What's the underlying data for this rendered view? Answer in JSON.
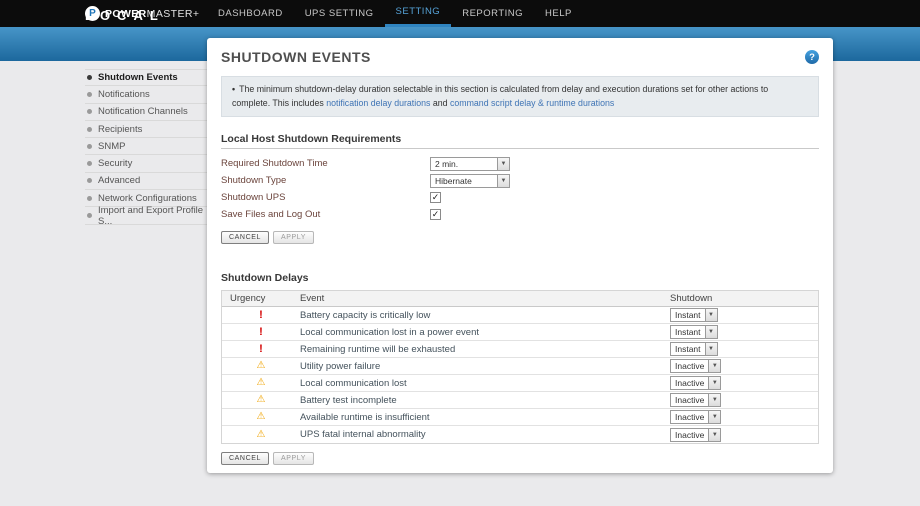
{
  "topbar": {
    "logo_letter": "P",
    "brand_bold": "POWER",
    "brand_light": "MASTER+",
    "nav": [
      {
        "label": "DASHBOARD"
      },
      {
        "label": "UPS SETTING"
      },
      {
        "label": "SETTING"
      },
      {
        "label": "REPORTING"
      },
      {
        "label": "HELP"
      }
    ]
  },
  "banner": {
    "title": "LOCAL"
  },
  "sidebar": {
    "items": [
      {
        "label": "Shutdown Events"
      },
      {
        "label": "Notifications"
      },
      {
        "label": "Notification Channels"
      },
      {
        "label": "Recipients"
      },
      {
        "label": "SNMP"
      },
      {
        "label": "Security"
      },
      {
        "label": "Advanced"
      },
      {
        "label": "Network Configurations"
      },
      {
        "label": "Import and Export Profile S..."
      }
    ]
  },
  "panel": {
    "title": "SHUTDOWN EVENTS",
    "help_glyph": "?",
    "notice": {
      "bullet": "•",
      "text_pre": "The minimum shutdown-delay duration selectable in this section is calculated from delay and execution durations set for other actions to complete. This includes ",
      "link1": "notification delay durations",
      "text_mid": " and ",
      "link2": "command script delay & runtime durations"
    },
    "requirements": {
      "heading": "Local Host Shutdown Requirements",
      "fields": [
        {
          "label": "Required Shutdown Time",
          "value": "2 min."
        },
        {
          "label": "Shutdown Type",
          "value": "Hibernate"
        },
        {
          "label": "Shutdown UPS",
          "check": "✓"
        },
        {
          "label": "Save Files and Log Out",
          "check": "✓"
        }
      ],
      "cancel_label": "CANCEL",
      "apply_label": "APPLY"
    },
    "delays": {
      "heading": "Shutdown Delays",
      "columns": [
        "Urgency",
        "Event",
        "Shutdown"
      ],
      "rows": [
        {
          "urgency": "critical",
          "icon": "!",
          "event": "Battery capacity is critically low",
          "shutdown": "Instant"
        },
        {
          "urgency": "critical",
          "icon": "!",
          "event": "Local communication lost in a power event",
          "shutdown": "Instant"
        },
        {
          "urgency": "critical",
          "icon": "!",
          "event": "Remaining runtime will be exhausted",
          "shutdown": "Instant"
        },
        {
          "urgency": "warning",
          "icon": "⚠",
          "event": "Utility power failure",
          "shutdown": "Inactive"
        },
        {
          "urgency": "warning",
          "icon": "⚠",
          "event": "Local communication lost",
          "shutdown": "Inactive"
        },
        {
          "urgency": "warning",
          "icon": "⚠",
          "event": "Battery test incomplete",
          "shutdown": "Inactive"
        },
        {
          "urgency": "warning",
          "icon": "⚠",
          "event": "Available runtime is insufficient",
          "shutdown": "Inactive"
        },
        {
          "urgency": "warning",
          "icon": "⚠",
          "event": "UPS fatal internal abnormality",
          "shutdown": "Inactive"
        }
      ],
      "cancel_label": "CANCEL",
      "apply_label": "APPLY"
    }
  },
  "select_arrow": "▼",
  "colors": {
    "accent_blue": "#2f84c0",
    "critical_red": "#d40000",
    "warning_orange": "#f0a300",
    "link_blue": "#3f74b5"
  }
}
